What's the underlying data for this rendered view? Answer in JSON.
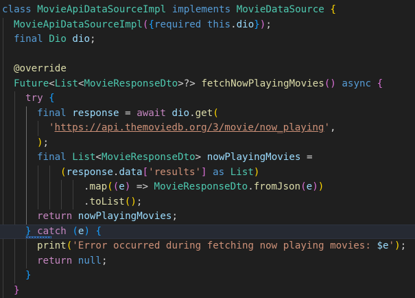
{
  "editor": {
    "language": "dart",
    "current_line": 15,
    "theme_colors": {
      "background": "#1f1f1f",
      "keyword": "#569cd6",
      "control": "#c586c0",
      "type": "#4ec9b0",
      "function": "#dcdcaa",
      "variable": "#9cdcfe",
      "string": "#ce9178",
      "bracket_gold": "#ffd700",
      "bracket_purple": "#da70d6",
      "bracket_blue": "#179fff"
    },
    "lines": [
      {
        "indent": 0,
        "tokens": [
          {
            "t": "class ",
            "c": "kw"
          },
          {
            "t": "MovieApiDataSourceImpl ",
            "c": "ty"
          },
          {
            "t": "implements ",
            "c": "kw"
          },
          {
            "t": "MovieDataSource ",
            "c": "ty"
          },
          {
            "t": "{",
            "c": "b1"
          }
        ]
      },
      {
        "indent": 1,
        "tokens": [
          {
            "t": "MovieApiDataSourceImpl",
            "c": "ty"
          },
          {
            "t": "(",
            "c": "b2"
          },
          {
            "t": "{",
            "c": "b3"
          },
          {
            "t": "required ",
            "c": "kw"
          },
          {
            "t": "this",
            "c": "kw"
          },
          {
            "t": ".",
            "c": "pl"
          },
          {
            "t": "dio",
            "c": "vr"
          },
          {
            "t": "}",
            "c": "b3"
          },
          {
            "t": ")",
            "c": "b2"
          },
          {
            "t": ";",
            "c": "pl"
          }
        ]
      },
      {
        "indent": 1,
        "tokens": [
          {
            "t": "final ",
            "c": "kw"
          },
          {
            "t": "Dio ",
            "c": "ty"
          },
          {
            "t": "dio",
            "c": "vr"
          },
          {
            "t": ";",
            "c": "pl"
          }
        ]
      },
      {
        "indent": 1,
        "tokens": []
      },
      {
        "indent": 1,
        "tokens": [
          {
            "t": "@override",
            "c": "dec"
          }
        ]
      },
      {
        "indent": 1,
        "tokens": [
          {
            "t": "Future",
            "c": "ty"
          },
          {
            "t": "<",
            "c": "pl"
          },
          {
            "t": "List",
            "c": "ty"
          },
          {
            "t": "<",
            "c": "pl"
          },
          {
            "t": "MovieResponseDto",
            "c": "ty"
          },
          {
            "t": ">?> ",
            "c": "pl"
          },
          {
            "t": "fetchNowPlayingMovies",
            "c": "fn"
          },
          {
            "t": "()",
            "c": "b2"
          },
          {
            "t": " ",
            "c": "pl"
          },
          {
            "t": "async ",
            "c": "kw"
          },
          {
            "t": "{",
            "c": "b2"
          }
        ]
      },
      {
        "indent": 2,
        "tokens": [
          {
            "t": "try ",
            "c": "kw2"
          },
          {
            "t": "{",
            "c": "b3"
          }
        ]
      },
      {
        "indent": 3,
        "tokens": [
          {
            "t": "final ",
            "c": "kw"
          },
          {
            "t": "response ",
            "c": "vr"
          },
          {
            "t": "= ",
            "c": "pl"
          },
          {
            "t": "await ",
            "c": "kw2"
          },
          {
            "t": "dio",
            "c": "vr"
          },
          {
            "t": ".",
            "c": "pl"
          },
          {
            "t": "get",
            "c": "fn"
          },
          {
            "t": "(",
            "c": "b1"
          }
        ]
      },
      {
        "indent": 4,
        "tokens": [
          {
            "t": "'",
            "c": "str"
          },
          {
            "t": "https://api.themoviedb.org/3/movie/now_playing",
            "c": "str url"
          },
          {
            "t": "'",
            "c": "str"
          },
          {
            "t": ",",
            "c": "pl"
          }
        ]
      },
      {
        "indent": 3,
        "tokens": [
          {
            "t": ")",
            "c": "b1"
          },
          {
            "t": ";",
            "c": "pl"
          }
        ]
      },
      {
        "indent": 3,
        "tokens": [
          {
            "t": "final ",
            "c": "kw"
          },
          {
            "t": "List",
            "c": "ty"
          },
          {
            "t": "<",
            "c": "pl"
          },
          {
            "t": "MovieResponseDto",
            "c": "ty"
          },
          {
            "t": "> ",
            "c": "pl"
          },
          {
            "t": "nowPlayingMovies ",
            "c": "vr"
          },
          {
            "t": "=",
            "c": "pl"
          }
        ]
      },
      {
        "indent": 5,
        "tokens": [
          {
            "t": "(",
            "c": "b1"
          },
          {
            "t": "response",
            "c": "vr"
          },
          {
            "t": ".",
            "c": "pl"
          },
          {
            "t": "data",
            "c": "vr"
          },
          {
            "t": "[",
            "c": "b2"
          },
          {
            "t": "'results'",
            "c": "str"
          },
          {
            "t": "]",
            "c": "b2"
          },
          {
            "t": " ",
            "c": "pl"
          },
          {
            "t": "as ",
            "c": "kw"
          },
          {
            "t": "List",
            "c": "ty"
          },
          {
            "t": ")",
            "c": "b1"
          }
        ]
      },
      {
        "indent": 7,
        "tokens": [
          {
            "t": ".",
            "c": "pl"
          },
          {
            "t": "map",
            "c": "fn"
          },
          {
            "t": "(",
            "c": "b1"
          },
          {
            "t": "(",
            "c": "b2"
          },
          {
            "t": "e",
            "c": "vr"
          },
          {
            "t": ")",
            "c": "b2"
          },
          {
            "t": " => ",
            "c": "pl"
          },
          {
            "t": "MovieResponseDto",
            "c": "ty"
          },
          {
            "t": ".",
            "c": "pl"
          },
          {
            "t": "fromJson",
            "c": "fn"
          },
          {
            "t": "(",
            "c": "b2"
          },
          {
            "t": "e",
            "c": "vr"
          },
          {
            "t": ")",
            "c": "b2"
          },
          {
            "t": ")",
            "c": "b1"
          }
        ]
      },
      {
        "indent": 7,
        "tokens": [
          {
            "t": ".",
            "c": "pl"
          },
          {
            "t": "toList",
            "c": "fn"
          },
          {
            "t": "()",
            "c": "b1"
          },
          {
            "t": ";",
            "c": "pl"
          }
        ]
      },
      {
        "indent": 3,
        "tokens": [
          {
            "t": "return ",
            "c": "kw2"
          },
          {
            "t": "nowPlayingMovies",
            "c": "vr"
          },
          {
            "t": ";",
            "c": "pl"
          }
        ]
      },
      {
        "indent": 2,
        "tokens": [
          {
            "t": "} ",
            "c": "b3"
          },
          {
            "t": "catch ",
            "c": "kw2"
          },
          {
            "t": "(",
            "c": "b3"
          },
          {
            "t": "e",
            "c": "vr"
          },
          {
            "t": ") ",
            "c": "b3"
          },
          {
            "t": "{",
            "c": "b3"
          }
        ]
      },
      {
        "indent": 3,
        "tokens": [
          {
            "t": "print",
            "c": "fn"
          },
          {
            "t": "(",
            "c": "b1"
          },
          {
            "t": "'Error occurred during fetching now playing movies: ",
            "c": "str"
          },
          {
            "t": "$e",
            "c": "vr"
          },
          {
            "t": "'",
            "c": "str"
          },
          {
            "t": ")",
            "c": "b1"
          },
          {
            "t": ";",
            "c": "pl"
          }
        ]
      },
      {
        "indent": 3,
        "tokens": [
          {
            "t": "return ",
            "c": "kw2"
          },
          {
            "t": "null",
            "c": "kw"
          },
          {
            "t": ";",
            "c": "pl"
          }
        ]
      },
      {
        "indent": 2,
        "tokens": [
          {
            "t": "}",
            "c": "b3"
          }
        ]
      },
      {
        "indent": 1,
        "tokens": [
          {
            "t": "}",
            "c": "b2"
          }
        ]
      }
    ]
  }
}
